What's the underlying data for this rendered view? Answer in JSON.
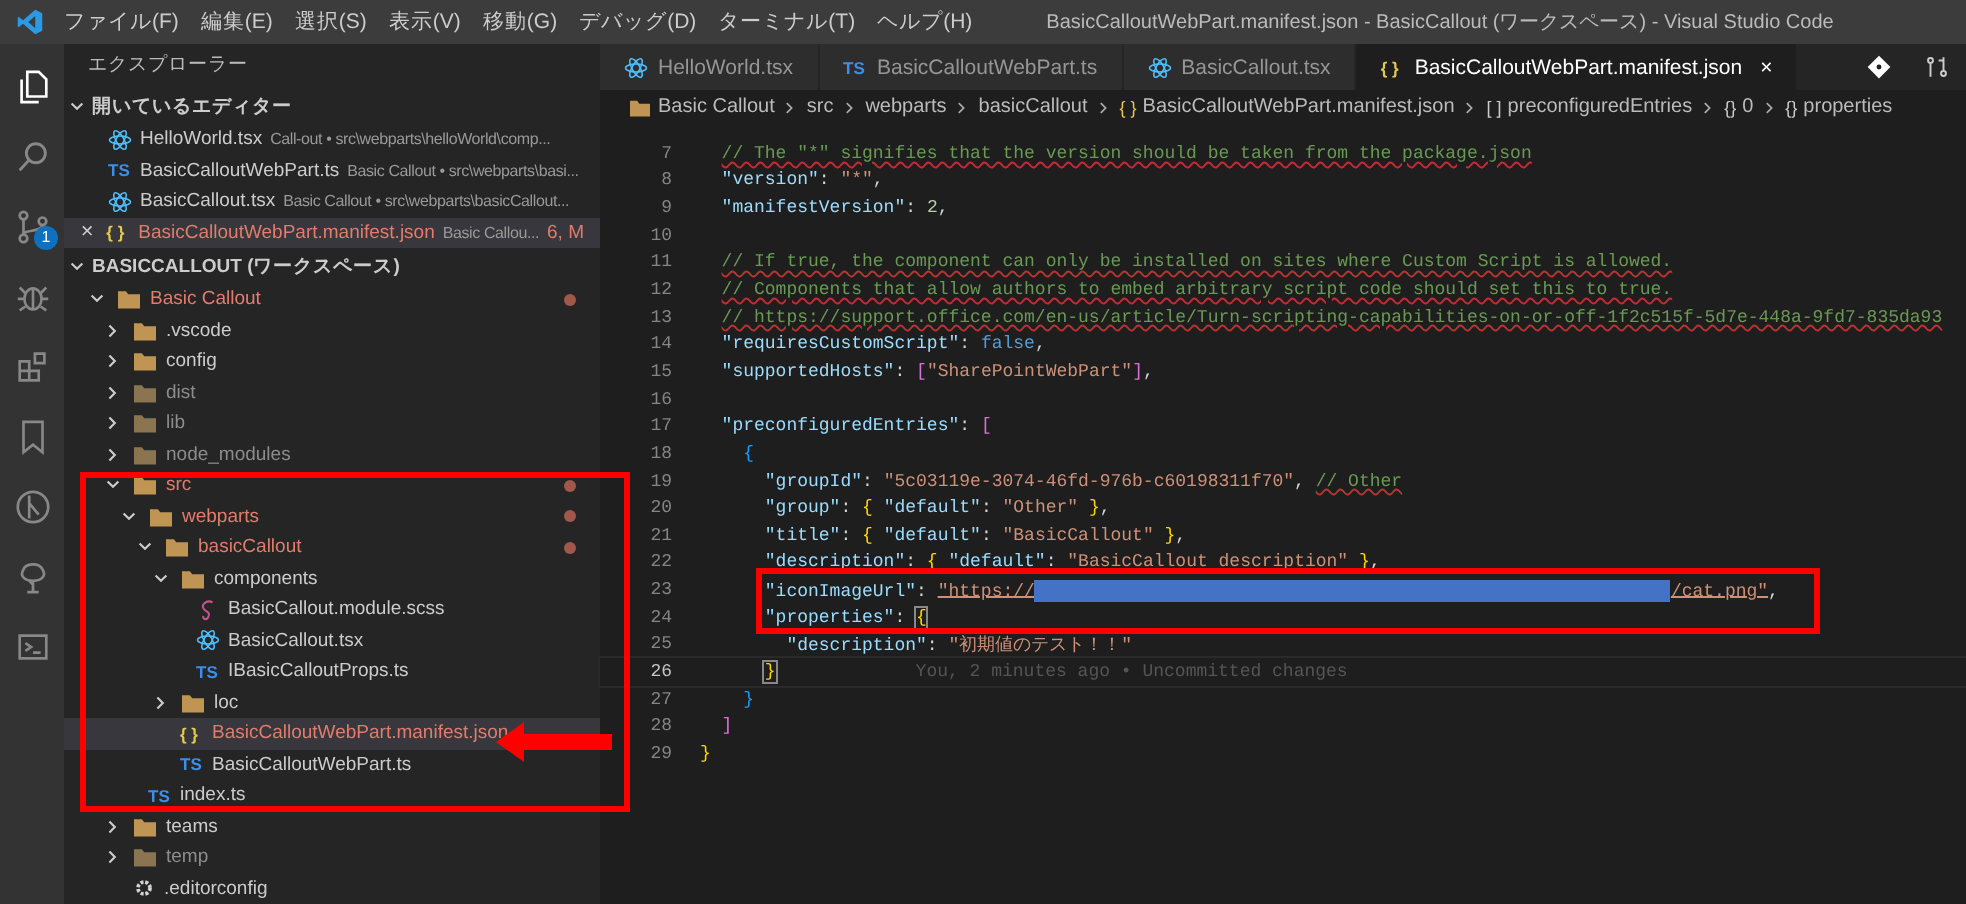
{
  "menu": [
    "ファイル(F)",
    "編集(E)",
    "選択(S)",
    "表示(V)",
    "移動(G)",
    "デバッグ(D)",
    "ターミナル(T)",
    "ヘルプ(H)"
  ],
  "window": {
    "title": "BasicCalloutWebPart.manifest.json - BasicCallout (ワークスペース) - Visual Studio Code"
  },
  "activity_bar": [
    {
      "kind": "files",
      "selected": true
    },
    {
      "kind": "search",
      "selected": false
    },
    {
      "kind": "scm",
      "selected": false,
      "badge": "1"
    },
    {
      "kind": "debug",
      "selected": false
    },
    {
      "kind": "extensions",
      "selected": false
    },
    {
      "kind": "bookmark",
      "selected": false
    },
    {
      "kind": "gitlens",
      "selected": false
    },
    {
      "kind": "tree",
      "selected": false
    },
    {
      "kind": "terminal",
      "selected": false
    }
  ],
  "sidebar": {
    "title": "エクスプローラー",
    "open_editors": {
      "title": "開いているエディター",
      "items": [
        {
          "name": "HelloWorld.tsx",
          "detail": "Call-out • src\\webparts\\helloWorld\\comp...",
          "kind": "tsx",
          "modified": false,
          "selected": false
        },
        {
          "name": "BasicCalloutWebPart.ts",
          "detail": "Basic Callout • src\\webparts\\basi...",
          "kind": "ts",
          "glyph": "TS",
          "modified": false,
          "selected": false
        },
        {
          "name": "BasicCallout.tsx",
          "detail": "Basic Callout • src\\webparts\\basicCallout...",
          "kind": "tsx",
          "modified": false,
          "selected": false
        },
        {
          "name": "BasicCalloutWebPart.manifest.json",
          "detail": "Basic Callou...",
          "kind": "json",
          "glyph": "{ }",
          "modified": true,
          "selected": true,
          "badge": "6, M",
          "close": "×"
        }
      ]
    },
    "workspace": {
      "title": "BASICCALLOUT (ワークスペース)",
      "tree": [
        {
          "name": "Basic Callout",
          "kind": "folder",
          "expanded": true,
          "modified": true,
          "ignored": false,
          "selected": false,
          "children": [
            {
              "name": ".vscode",
              "kind": "folder",
              "expanded": false,
              "modified": false,
              "ignored": false,
              "selected": false
            },
            {
              "name": "config",
              "kind": "folder",
              "expanded": false,
              "modified": false,
              "ignored": false,
              "selected": false
            },
            {
              "name": "dist",
              "kind": "folder",
              "expanded": false,
              "modified": false,
              "ignored": true,
              "selected": false
            },
            {
              "name": "lib",
              "kind": "folder",
              "expanded": false,
              "modified": false,
              "ignored": true,
              "selected": false
            },
            {
              "name": "node_modules",
              "kind": "folder",
              "expanded": false,
              "modified": false,
              "ignored": true,
              "selected": false
            },
            {
              "name": "src",
              "kind": "folder",
              "expanded": true,
              "modified": true,
              "ignored": false,
              "selected": false,
              "children": [
                {
                  "name": "webparts",
                  "kind": "folder",
                  "expanded": true,
                  "modified": true,
                  "ignored": false,
                  "selected": false,
                  "children": [
                    {
                      "name": "basicCallout",
                      "kind": "folder",
                      "expanded": true,
                      "modified": true,
                      "ignored": false,
                      "selected": false,
                      "children": [
                        {
                          "name": "components",
                          "kind": "folder",
                          "expanded": true,
                          "modified": false,
                          "ignored": false,
                          "selected": false,
                          "children": [
                            {
                              "name": "BasicCallout.module.scss",
                              "kind": "scss",
                              "modified": false,
                              "ignored": false,
                              "selected": false
                            },
                            {
                              "name": "BasicCallout.tsx",
                              "kind": "tsx",
                              "modified": false,
                              "ignored": false,
                              "selected": false
                            },
                            {
                              "name": "IBasicCalloutProps.ts",
                              "kind": "ts",
                              "glyph": "TS",
                              "modified": false,
                              "ignored": false,
                              "selected": false
                            }
                          ]
                        },
                        {
                          "name": "loc",
                          "kind": "folder",
                          "expanded": false,
                          "modified": false,
                          "ignored": false,
                          "selected": false
                        },
                        {
                          "name": "BasicCalloutWebPart.manifest.json",
                          "kind": "json",
                          "glyph": "{ }",
                          "modified": true,
                          "ignored": false,
                          "selected": true
                        },
                        {
                          "name": "BasicCalloutWebPart.ts",
                          "kind": "ts",
                          "glyph": "TS",
                          "modified": false,
                          "ignored": false,
                          "selected": false
                        }
                      ]
                    }
                  ]
                },
                {
                  "name": "index.ts",
                  "kind": "ts",
                  "glyph": "TS",
                  "modified": false,
                  "ignored": false,
                  "selected": false
                }
              ]
            },
            {
              "name": "teams",
              "kind": "folder",
              "expanded": false,
              "modified": false,
              "ignored": false,
              "selected": false
            },
            {
              "name": "temp",
              "kind": "folder",
              "expanded": false,
              "modified": false,
              "ignored": true,
              "selected": false
            },
            {
              "name": ".editorconfig",
              "kind": "config",
              "modified": false,
              "ignored": false,
              "selected": false
            }
          ]
        }
      ]
    }
  },
  "tabs": [
    {
      "label": "HelloWorld.tsx",
      "kind": "tsx",
      "selected": false
    },
    {
      "label": "BasicCalloutWebPart.ts",
      "kind": "ts",
      "glyph": "TS",
      "selected": false
    },
    {
      "label": "BasicCallout.tsx",
      "kind": "tsx",
      "selected": false
    },
    {
      "label": "BasicCalloutWebPart.manifest.json",
      "kind": "json",
      "glyph": "{ }",
      "selected": true,
      "close": "×"
    }
  ],
  "breadcrumb": [
    {
      "label": "Basic Callout",
      "kind": "folder"
    },
    {
      "label": "src"
    },
    {
      "label": "webparts"
    },
    {
      "label": "basicCallout"
    },
    {
      "label": "BasicCalloutWebPart.manifest.json",
      "glyph": "{ }"
    },
    {
      "label": "preconfiguredEntries",
      "glyph": "[ ]"
    },
    {
      "label": "0",
      "glyph": "{}"
    },
    {
      "label": "properties",
      "glyph": "{}"
    }
  ],
  "code": [
    {
      "number": "7",
      "current": false,
      "tokens": [
        {
          "kind": "comment",
          "text": "// The \"*\" signifies that the version should be taken from the package.json"
        }
      ]
    },
    {
      "number": "8",
      "current": false,
      "tokens": [
        {
          "kind": "key",
          "text": "\"version\""
        },
        {
          "kind": "punct",
          "text": ": "
        },
        {
          "kind": "string",
          "text": "\"*\""
        },
        {
          "kind": "punct",
          "text": ","
        }
      ]
    },
    {
      "number": "9",
      "current": false,
      "tokens": [
        {
          "kind": "key",
          "text": "\"manifestVersion\""
        },
        {
          "kind": "punct",
          "text": ": "
        },
        {
          "kind": "number",
          "text": "2"
        },
        {
          "kind": "punct",
          "text": ","
        }
      ]
    },
    {
      "number": "10",
      "current": false
    },
    {
      "number": "11",
      "current": false,
      "tokens": [
        {
          "kind": "comment",
          "text": "// If true, the component can only be installed on sites where Custom Script is allowed."
        }
      ]
    },
    {
      "number": "12",
      "current": false,
      "tokens": [
        {
          "kind": "comment",
          "text": "// Components that allow authors to embed arbitrary script code should set this to true."
        }
      ]
    },
    {
      "number": "13",
      "current": false,
      "tokens": [
        {
          "kind": "comment",
          "text": "// https://support.office.com/en-us/article/Turn-scripting-capabilities-on-or-off-1f2c515f-5d7e-448a-9fd7-835da93"
        }
      ]
    },
    {
      "number": "14",
      "current": false,
      "tokens": [
        {
          "kind": "key",
          "text": "\"requiresCustomScript\""
        },
        {
          "kind": "punct",
          "text": ": "
        },
        {
          "kind": "keyword",
          "text": "false"
        },
        {
          "kind": "punct",
          "text": ","
        }
      ]
    },
    {
      "number": "15",
      "current": false,
      "tokens": [
        {
          "kind": "key",
          "text": "\"supportedHosts\""
        },
        {
          "kind": "punct",
          "text": ": "
        },
        {
          "kind": "open",
          "text": "["
        },
        {
          "kind": "string",
          "text": "\"SharePointWebPart\""
        },
        {
          "kind": "close",
          "text": "]"
        },
        {
          "kind": "punct",
          "text": ","
        }
      ]
    },
    {
      "number": "16",
      "current": false
    },
    {
      "number": "17",
      "current": false,
      "tokens": [
        {
          "kind": "key",
          "text": "\"preconfiguredEntries\""
        },
        {
          "kind": "punct",
          "text": ": "
        },
        {
          "kind": "open",
          "text": "["
        }
      ]
    },
    {
      "number": "18",
      "current": false,
      "tokens": [
        {
          "kind": "open",
          "text": "{"
        }
      ]
    },
    {
      "number": "19",
      "current": false,
      "tokens": [
        {
          "kind": "key",
          "text": "\"groupId\""
        },
        {
          "kind": "punct",
          "text": ": "
        },
        {
          "kind": "string",
          "text": "\"5c03119e-3074-46fd-976b-c60198311f70\""
        },
        {
          "kind": "punct",
          "text": ", "
        },
        {
          "kind": "comment",
          "text": "// Other"
        }
      ]
    },
    {
      "number": "20",
      "current": false,
      "tokens": [
        {
          "kind": "key",
          "text": "\"group\""
        },
        {
          "kind": "punct",
          "text": ": "
        },
        {
          "kind": "open",
          "text": "{"
        },
        {
          "kind": "key",
          "text": " \"default\""
        },
        {
          "kind": "punct",
          "text": ": "
        },
        {
          "kind": "string",
          "text": "\"Other\" "
        },
        {
          "kind": "close",
          "text": "}"
        },
        {
          "kind": "punct",
          "text": ","
        }
      ]
    },
    {
      "number": "21",
      "current": false,
      "tokens": [
        {
          "kind": "key",
          "text": "\"title\""
        },
        {
          "kind": "punct",
          "text": ": "
        },
        {
          "kind": "open",
          "text": "{"
        },
        {
          "kind": "key",
          "text": " \"default\""
        },
        {
          "kind": "punct",
          "text": ": "
        },
        {
          "kind": "string",
          "text": "\"BasicCallout\" "
        },
        {
          "kind": "close",
          "text": "}"
        },
        {
          "kind": "punct",
          "text": ","
        }
      ]
    },
    {
      "number": "22",
      "current": false,
      "tokens": [
        {
          "kind": "key",
          "text": "\"description\""
        },
        {
          "kind": "punct",
          "text": ": "
        },
        {
          "kind": "open",
          "text": "{"
        },
        {
          "kind": "key",
          "text": " \"default\""
        },
        {
          "kind": "punct",
          "text": ": "
        },
        {
          "kind": "string",
          "text": "\"BasicCallout description\" "
        },
        {
          "kind": "close",
          "text": "}"
        },
        {
          "kind": "punct",
          "text": ","
        }
      ]
    },
    {
      "number": "23",
      "current": false,
      "tokens": [
        {
          "kind": "key",
          "text": "\"iconImageUrl\""
        },
        {
          "kind": "punct",
          "text": ": "
        },
        {
          "kind": "link",
          "text": "\"https://"
        },
        {
          "kind": "redacted"
        },
        {
          "kind": "link",
          "text": "/cat.png\""
        },
        {
          "kind": "punct",
          "text": ","
        }
      ]
    },
    {
      "number": "24",
      "current": false,
      "tokens": [
        {
          "kind": "key",
          "text": "\"properties\""
        },
        {
          "kind": "punct",
          "text": ": "
        },
        {
          "kind": "open",
          "text": "{",
          "matched": true
        }
      ]
    },
    {
      "number": "25",
      "current": false,
      "tokens": [
        {
          "kind": "key",
          "text": "\"description\""
        },
        {
          "kind": "punct",
          "text": ": "
        },
        {
          "kind": "string",
          "text": "\"初期値のテスト！！\""
        }
      ]
    },
    {
      "number": "26",
      "current": true,
      "tokens": [
        {
          "kind": "close",
          "text": "}",
          "matched": true
        },
        {
          "kind": "blame",
          "text": "You, 2 minutes ago • Uncommitted changes"
        }
      ]
    },
    {
      "number": "27",
      "current": false,
      "tokens": [
        {
          "kind": "close",
          "text": "}"
        }
      ]
    },
    {
      "number": "28",
      "current": false,
      "tokens": [
        {
          "kind": "close",
          "text": "]"
        }
      ]
    },
    {
      "number": "29",
      "current": false,
      "tokens": [
        {
          "kind": "close",
          "text": "}"
        }
      ]
    }
  ]
}
